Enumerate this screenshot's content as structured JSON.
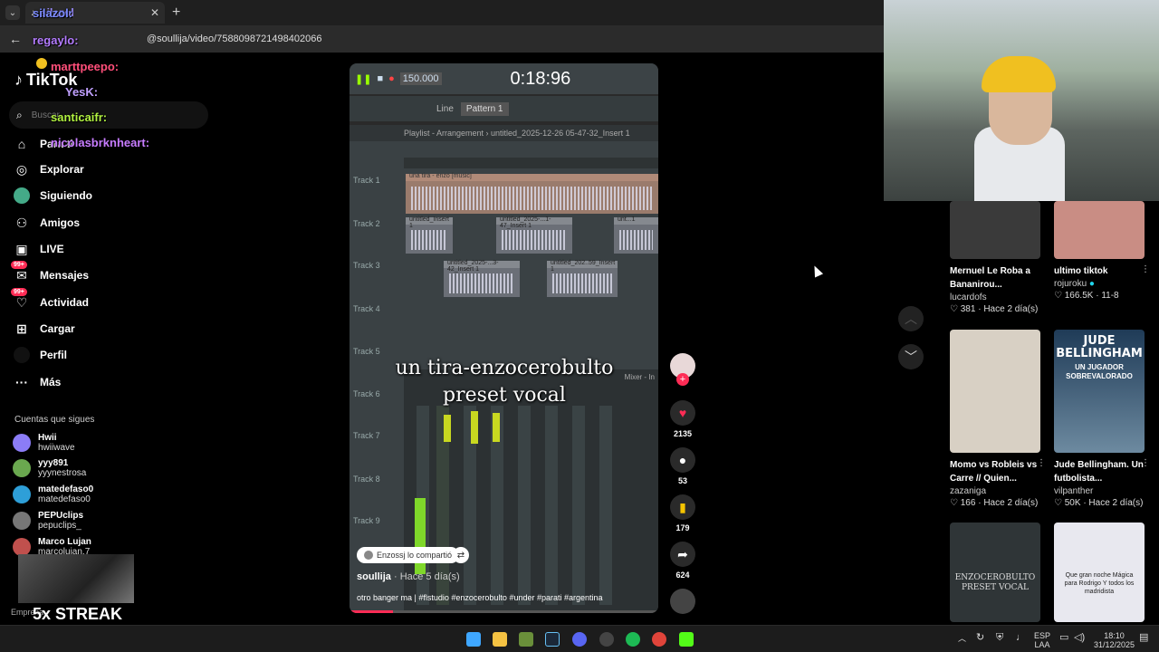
{
  "browser": {
    "tab_title": "silazol",
    "url": "@soullija/video/7588098721498402066"
  },
  "chat": {
    "names": [
      "silazol:",
      "regaylo:",
      "marttpeepo:",
      "YesK:",
      "santicaifr:",
      "nicolasbrknheart:"
    ]
  },
  "sidebar": {
    "logo": "TikTok",
    "search_placeholder": "Buscar",
    "nav": [
      {
        "label": "Para ti",
        "icon": "home-icon"
      },
      {
        "label": "Explorar",
        "icon": "compass-icon"
      },
      {
        "label": "Siguiendo",
        "icon": "following-icon"
      },
      {
        "label": "Amigos",
        "icon": "friends-icon"
      },
      {
        "label": "LIVE",
        "icon": "live-icon"
      },
      {
        "label": "Mensajes",
        "icon": "messages-icon",
        "badge": "99+"
      },
      {
        "label": "Actividad",
        "icon": "activity-icon",
        "badge": "99+"
      },
      {
        "label": "Cargar",
        "icon": "upload-icon"
      },
      {
        "label": "Perfil",
        "icon": "profile-icon"
      },
      {
        "label": "Más",
        "icon": "more-icon"
      }
    ],
    "following_title": "Cuentas que sigues",
    "following": [
      {
        "name": "Hwii",
        "handle": "hwiiwave",
        "color": "#8b7cf6"
      },
      {
        "name": "yyy891",
        "handle": "yyynestrosa",
        "color": "#6aa84f"
      },
      {
        "name": "matedefaso0",
        "handle": "matedefaso0",
        "color": "#2e9fd8"
      },
      {
        "name": "PEPUclips",
        "handle": "pepuclips_",
        "color": "#777"
      },
      {
        "name": "Marco Lujan",
        "handle": "marcolujan.7",
        "color": "#c0504d"
      }
    ],
    "streak": "5x STREAK",
    "footer": "Empresa"
  },
  "video": {
    "fl_time": "0:18:96",
    "fl_tempo": "150.000",
    "fl_pattern": "Pattern 1",
    "fl_line": "Line",
    "playlist_header": "Playlist - Arrangement › untitled_2025-12-26 05-47-32_Insert 1",
    "tracks": [
      "Track 1",
      "Track 2",
      "Track 3",
      "Track 4",
      "Track 5",
      "Track 6",
      "Track 7",
      "Track 8",
      "Track 9"
    ],
    "clip_labels": [
      "una tira - enzo [music]",
      "untitled_Insert 1",
      "untitled_2025-...1-47_Insert 1",
      "unt...1",
      "untitled_2025-...3-42_Insert 1",
      "untitled_202..59_Insert 1"
    ],
    "mixer_label": "Mixer - In",
    "caption_line1": "un tira-enzocerobulto",
    "caption_line2": "preset vocal",
    "shared_label": "Enzossj lo compartió",
    "author": "soullija",
    "time_ago": "· Hace 5 día(s)",
    "description": "otro banger ma | #flstudio #enzocerobulto #under #parati #argentina",
    "progress": 0.14
  },
  "actions": {
    "likes": "2135",
    "comments": "53",
    "saves": "179",
    "shares": "624"
  },
  "grid": [
    {
      "title": "Mernuel Le Roba a Bananirou...",
      "user": "lucardofs",
      "meta": "♡ 381 · Hace 2 día(s)",
      "bg": "#3a3a3a"
    },
    {
      "title": "ultimo tiktok",
      "user": "rojuroku",
      "meta": "♡ 166.5K · 11-8",
      "bg": "#c98d84"
    },
    {
      "title": "Momo vs Robleis vs Carre // Quien...",
      "user": "zazaniga",
      "meta": "♡ 166 · Hace 2 día(s)",
      "bg": "#d8d0c4"
    },
    {
      "title": "Jude Bellingham. Un futbolista...",
      "user": "vilpanther",
      "meta": "♡ 50K · Hace 2 día(s)",
      "bg": "#1f3b57",
      "overlay": "JUDE BELLINGHAM",
      "overlay2": "UN JUGADOR SOBREVALORADO"
    },
    {
      "title": "",
      "user": "",
      "meta": "",
      "bg": "#2f3537",
      "overlay": "ENZOCEROBULTO PRESET VOCAL"
    },
    {
      "title": "",
      "user": "",
      "meta": "",
      "bg": "#e8e8ef",
      "overlay": "Que gran noche Mágica para Rodrigo Y todos los madridista"
    }
  ],
  "taskbar": {
    "lang1": "ESP",
    "lang2": "LAA",
    "time": "18:10",
    "date": "31/12/2025"
  }
}
